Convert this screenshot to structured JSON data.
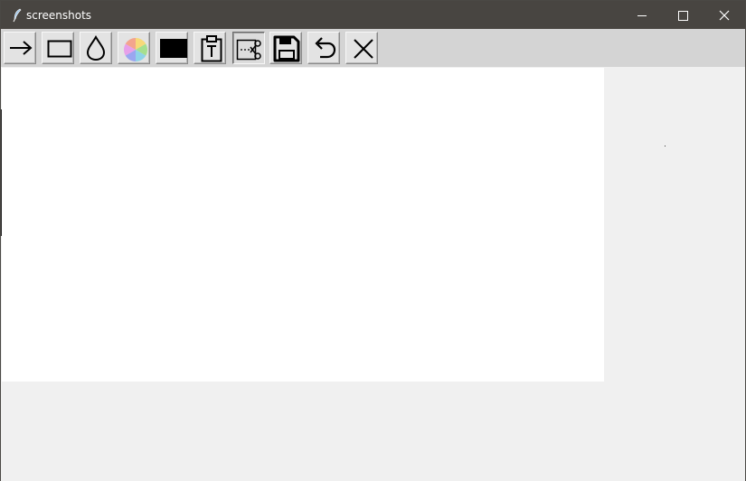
{
  "window": {
    "title": "screenshots",
    "icon": "feather-icon",
    "controls": [
      "minimize-icon",
      "maximize-icon",
      "close-icon"
    ]
  },
  "toolbar": {
    "tools": [
      {
        "name": "arrow-tool",
        "icon": "arrow-right-icon"
      },
      {
        "name": "rectangle-tool",
        "icon": "rectangle-icon"
      },
      {
        "name": "blur-tool",
        "icon": "droplet-icon"
      },
      {
        "name": "color-picker-tool",
        "icon": "color-wheel-icon"
      },
      {
        "name": "fill-color-tool",
        "icon": "black-swatch-icon",
        "color": "#000000"
      },
      {
        "name": "text-tool",
        "icon": "clipboard-text-icon"
      },
      {
        "name": "crop-tool",
        "icon": "scissors-crop-icon",
        "active": true
      },
      {
        "name": "save-tool",
        "icon": "floppy-disk-icon"
      },
      {
        "name": "undo-tool",
        "icon": "undo-icon"
      },
      {
        "name": "close-tool",
        "icon": "x-icon"
      }
    ]
  },
  "colors": {
    "titlebar": "#484541",
    "toolbar": "#d4d4d4",
    "canvas": "#ffffff",
    "background": "#f0f0f0"
  }
}
